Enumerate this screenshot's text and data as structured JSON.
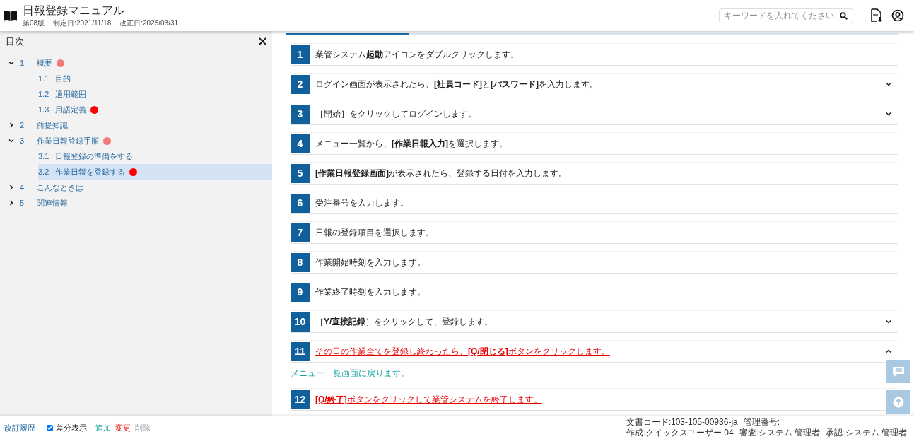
{
  "header": {
    "title": "日報登録マニュアル",
    "edition": "第08版",
    "created": "制定日:2021/11/18",
    "revised": "改正日:2025/03/31",
    "search": {
      "placeholder": "キーワードを入れてください"
    }
  },
  "toc": {
    "title": "目次",
    "items": [
      {
        "number": "1.",
        "label": "概要",
        "expanded": true,
        "selected": false,
        "color": "#f47a7a",
        "children": [
          {
            "number": "1.1",
            "label": "目的",
            "selected": false
          },
          {
            "number": "1.2",
            "label": "適用範囲",
            "selected": false
          },
          {
            "number": "1.3",
            "label": "用語定義",
            "selected": false,
            "color": "#ff0000"
          }
        ]
      },
      {
        "number": "2.",
        "label": "前提知識",
        "expanded": false,
        "selected": false
      },
      {
        "number": "3.",
        "label": "作業日報登録手順",
        "expanded": true,
        "selected": false,
        "color": "#f47a7a",
        "children": [
          {
            "number": "3.1",
            "label": "日報登録の準備をする",
            "selected": false
          },
          {
            "number": "3.2",
            "label": "作業日報を登録する",
            "selected": true,
            "color": "#ff0000"
          }
        ]
      },
      {
        "number": "4.",
        "label": "こんなときは",
        "expanded": false,
        "selected": false
      },
      {
        "number": "5.",
        "label": "関連情報",
        "expanded": false,
        "selected": false
      }
    ]
  },
  "steps": [
    {
      "number": "1",
      "text": "業管システム**起動**アイコンをダブルクリックします。",
      "kind": "normal"
    },
    {
      "number": "2",
      "text": "ログイン画面が表示されたら、**[社員コード]**と**[パスワード]**を入力します。",
      "kind": "normal",
      "expanded": false
    },
    {
      "number": "3",
      "text": "［開始］をクリックしてログインします。",
      "kind": "normal",
      "expanded": false
    },
    {
      "number": "4",
      "text": "メニュー一覧から、**[作業日報入力]**を選択します。",
      "kind": "normal"
    },
    {
      "number": "5",
      "text": "**[作業日報登録画面]**が表示されたら、登録する日付を入力します。",
      "kind": "normal"
    },
    {
      "number": "6",
      "text": "受注番号を入力します。",
      "kind": "normal"
    },
    {
      "number": "7",
      "text": "日報の登録項目を選択します。",
      "kind": "normal"
    },
    {
      "number": "8",
      "text": "作業開始時刻を入力します。",
      "kind": "normal"
    },
    {
      "number": "9",
      "text": "作業終了時刻を入力します。",
      "kind": "normal"
    },
    {
      "number": "10",
      "text": "［**Y/直接記録**］をクリックして、登録します。",
      "kind": "normal",
      "expanded": false
    },
    {
      "number": "11",
      "text": "その日の作業全てを登録し終わったら、**[Q/閉じる]**ボタンをクリックします。",
      "kind": "changed",
      "expanded": true,
      "detail": "メニュー一覧画面に戻ります。"
    },
    {
      "number": "12",
      "text": "**[Q/終了]**ボタンをクリックして業管システムを終了します。",
      "kind": "changed"
    }
  ],
  "footer": {
    "history": "改訂履歴",
    "diff": {
      "label": "差分表示",
      "checked": true
    },
    "legend": [
      {
        "kind": "added",
        "label": "追加"
      },
      {
        "kind": "changed",
        "label": "変更"
      },
      {
        "kind": "deleted",
        "label": "削除"
      }
    ],
    "doc_code": "文書コード:103-105-00936-ja",
    "manage_no": "管理番号:",
    "author": "作成:クイックスユーザー 04",
    "reviewer": "審査:システム 管理者",
    "approver": "承認:システム 管理者"
  }
}
